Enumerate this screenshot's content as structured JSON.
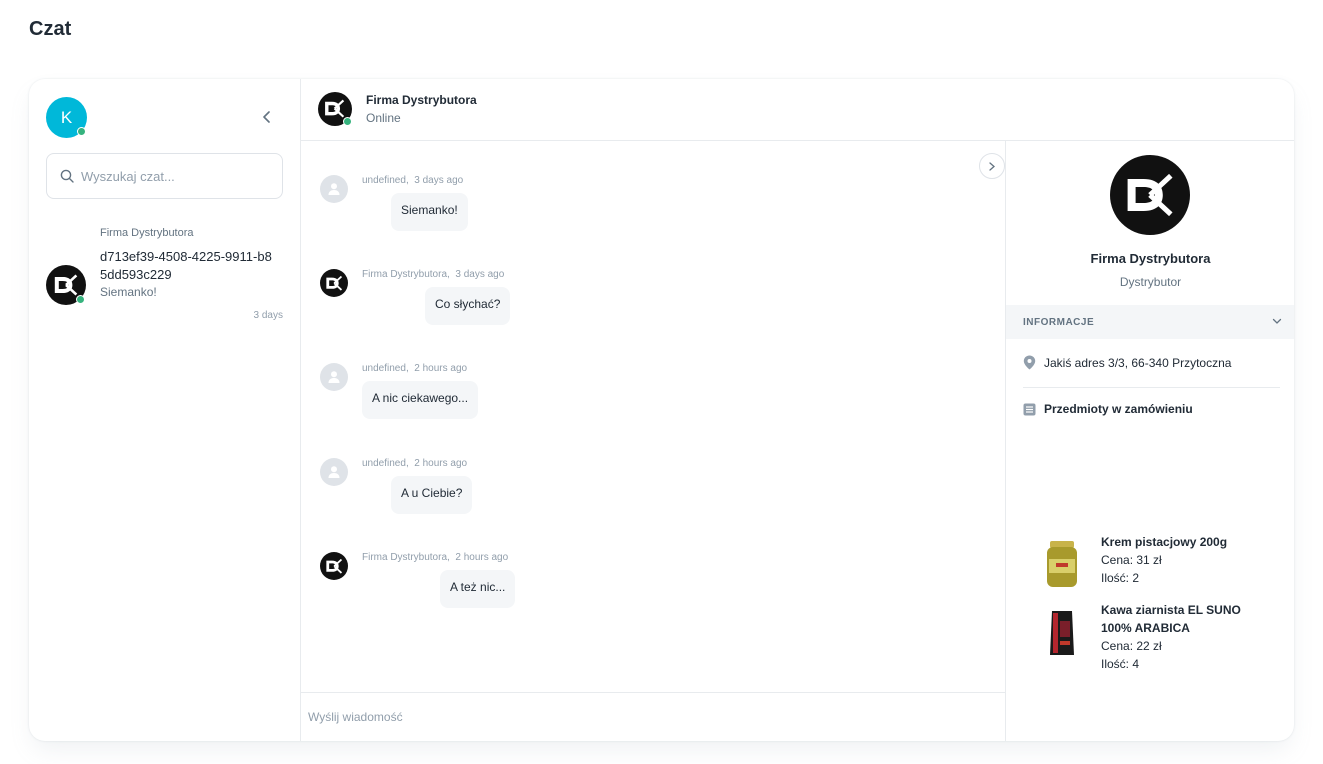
{
  "page": {
    "title": "Czat"
  },
  "sidebar": {
    "me_initial": "K",
    "search_placeholder": "Wyszukaj czat...",
    "conversations": [
      {
        "sender": "Firma Dystrybutora",
        "id": "d713ef39-4508-4225-9911-b85dd593c229",
        "preview": "Siemanko!",
        "time": "3 days"
      }
    ]
  },
  "header": {
    "name": "Firma Dystrybutora",
    "status": "Online"
  },
  "messages": [
    {
      "author": "undefined",
      "time": "3 days ago",
      "text": "Siemanko!"
    },
    {
      "author": "Firma Dystrybutora",
      "time": "3 days ago",
      "text": "Co słychać?"
    },
    {
      "author": "undefined",
      "time": "2 hours ago",
      "text": "A nic ciekawego..."
    },
    {
      "author": "undefined",
      "time": "2 hours ago",
      "text": "A u Ciebie?"
    },
    {
      "author": "Firma Dystrybutora",
      "time": "2 hours ago",
      "text": "A też nic..."
    }
  ],
  "composer": {
    "placeholder": "Wyślij wiadomość"
  },
  "info_panel": {
    "name": "Firma Dystrybutora",
    "role": "Dystrybutor",
    "section_title": "INFORMACJE",
    "address": "Jakiś adres 3/3, 66-340 Przytoczna",
    "items_title": "Przedmioty w zamówieniu",
    "products": [
      {
        "name": "Krem pistacjowy 200g",
        "price": "Cena: 31 zł",
        "qty": "Ilość: 2"
      },
      {
        "name": "Kawa ziarnista EL SUNO 100% ARABICA",
        "price": "Cena: 22 zł",
        "qty": "Ilość: 4"
      }
    ]
  },
  "colors": {
    "accent_avatar": "#00b8d9",
    "online": "#36b37e",
    "bubble": "#f4f6f8"
  }
}
